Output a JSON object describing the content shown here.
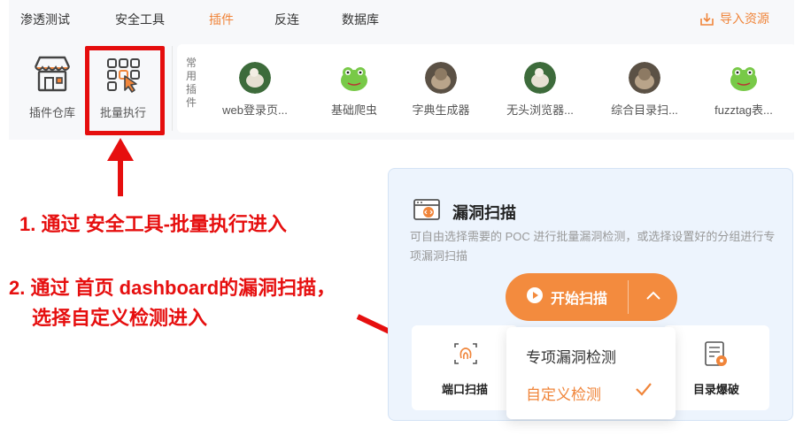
{
  "topnav": {
    "items": [
      "渗透测试",
      "安全工具",
      "插件",
      "反连",
      "数据库"
    ],
    "active_index": 2,
    "import_label": "导入资源"
  },
  "toolbar": {
    "store_label": "插件仓库",
    "batch_label": "批量执行",
    "common_label": "常用插件",
    "plugins": [
      {
        "name": "web登录页...",
        "icon": "sheep-avatar"
      },
      {
        "name": "基础爬虫",
        "icon": "frog-avatar"
      },
      {
        "name": "字典生成器",
        "icon": "cat-avatar"
      },
      {
        "name": "无头浏览器...",
        "icon": "sheep-avatar"
      },
      {
        "name": "综合目录扫...",
        "icon": "cat-avatar"
      },
      {
        "name": "fuzztag表...",
        "icon": "frog-avatar"
      }
    ]
  },
  "annotations": {
    "line1": "1. 通过 安全工具-批量执行进入",
    "line2a": "2. 通过 首页 dashboard的漏洞扫描，",
    "line2b": "选择自定义检测进入"
  },
  "vuln_card": {
    "title": "漏洞扫描",
    "description": "可自由选择需要的 POC 进行批量漏洞检测，或选择设置好的分组进行专项漏洞扫描",
    "start_label": "开始扫描",
    "tiles": [
      "端口扫描",
      "目录爆破"
    ],
    "dropdown": {
      "items": [
        "专项漏洞检测",
        "自定义检测"
      ],
      "selected_index": 1
    }
  },
  "colors": {
    "accent": "#f0853a",
    "button": "#f38b3e",
    "annotation_red": "#e60f0f",
    "card_bg": "#edf4fd"
  }
}
